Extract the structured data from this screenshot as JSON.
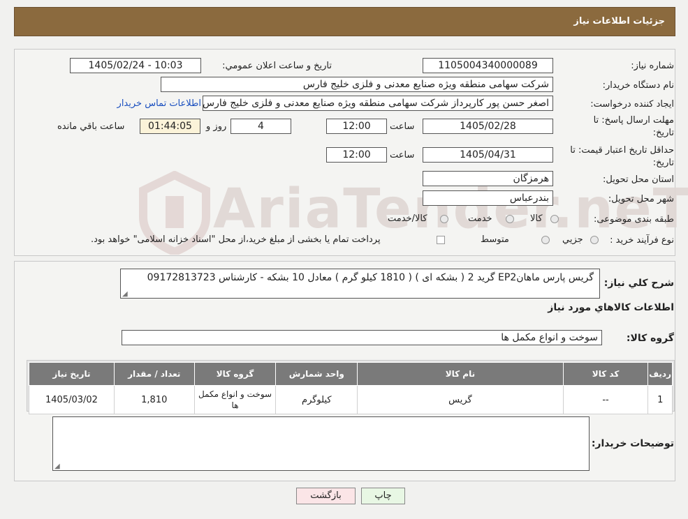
{
  "header": {
    "title": "جزئیات اطلاعات نیاز"
  },
  "watermark": {
    "text": "AriaTender.neT"
  },
  "form": {
    "need_number_label": "شماره نیاز:",
    "need_number": "1105004340000089",
    "announce_label": "تاريخ و ساعت اعلان عمومي:",
    "announce_value": "1405/02/24 - 10:03",
    "buyer_label": "نام دستگاه خريدار:",
    "buyer_value": "شرکت سهامی منطقه ویژه صنایع معدنی و فلزی خلیج فارس",
    "creator_label": "ايجاد کننده درخواست:",
    "creator_value": "اصغر حسن پور کارپرداز شرکت سهامی منطقه ویژه صنایع معدنی و فلزی خلیج فارس",
    "contact_link": "اطلاعات تماس خريدار",
    "deadline_label_1": "مهلت ارسال پاسخ: تا",
    "deadline_label_2": "تاريخ:",
    "deadline_date": "1405/02/28",
    "time_label": "ساعت",
    "deadline_time": "12:00",
    "days_value": "4",
    "days_label": "روز و",
    "remaining_time": "01:44:05",
    "remaining_label": "ساعت باقي مانده",
    "validity_label_1": "حداقل تاريخ اعتبار قيمت: تا",
    "validity_label_2": "تاريخ:",
    "validity_date": "1405/04/31",
    "validity_time": "12:00",
    "province_label": "استان محل تحويل:",
    "province_value": "هرمزگان",
    "city_label": "شهر محل تحويل:",
    "city_value": "بندرعباس",
    "category_label": "طبقه بندی موضوعی:",
    "category_options": [
      "کالا",
      "خدمت",
      "کالا/خدمت"
    ],
    "process_label": "نوع فرآيند خريد :",
    "process_options": [
      "جزيي",
      "متوسط"
    ],
    "process_note": "پرداخت تمام يا بخشی از مبلغ خريد،از محل \"اسناد خزانه اسلامی\" خواهد بود."
  },
  "summary": {
    "label": "شرح کلي نياز:",
    "value": "گریس پارس ماهانEP2 گرید 2 ( بشکه ای )   ( 1810 کیلو گرم  ) معادل 10 بشکه - کارشناس 09172813723",
    "items_title": "اطلاعات کالاهاي مورد نياز",
    "group_label": "گروه کالا:",
    "group_value": "سوخت و انواع مکمل ها"
  },
  "table": {
    "headers": [
      "رديف",
      "کد کالا",
      "نام کالا",
      "واحد شمارش",
      "گروه کالا",
      "تعداد / مقدار",
      "تاريخ نياز"
    ],
    "rows": [
      [
        "1",
        "--",
        "گريس",
        "کيلوگرم",
        "سوخت و انواع مکمل ها",
        "1,810",
        "1405/03/02"
      ]
    ]
  },
  "buyer_notes": {
    "label": "توضيحات خريدار:",
    "value": ""
  },
  "buttons": {
    "print": "چاپ",
    "back": "بازگشت"
  }
}
